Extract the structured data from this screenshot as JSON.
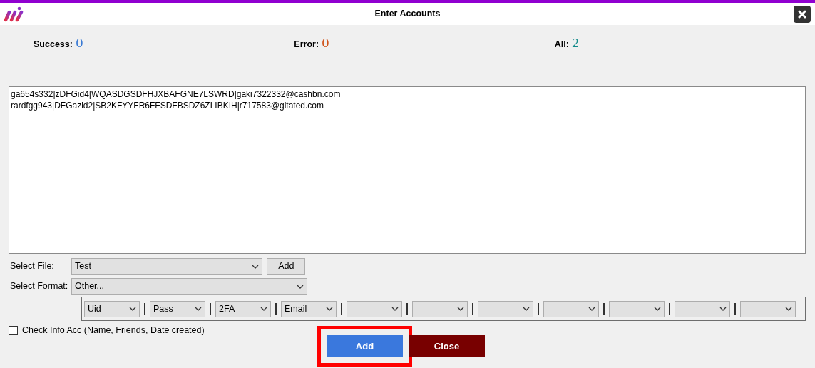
{
  "window": {
    "title": "Enter Accounts"
  },
  "stats": [
    {
      "label": "Success:",
      "value": "0",
      "color": "#3a7bd5"
    },
    {
      "label": "Error:",
      "value": "0",
      "color": "#d0531a"
    },
    {
      "label": "All:",
      "value": "2",
      "color": "#138a8a"
    }
  ],
  "accounts_text": {
    "lines": [
      "ga654s332|zDFGid4|WQASDGSDFHJXBAFGNE7LSWRD|gaki7322332@cashbn.com",
      "rardfgg943|DFGazid2|SB2KFYYFR6FFSDFBSDZ6ZLIBKIH|r717583@gitated.com"
    ]
  },
  "select_file": {
    "label": "Select File:",
    "value": "Test",
    "button": "Add"
  },
  "select_format": {
    "label": "Select Format:",
    "value": "Other..."
  },
  "format_columns": [
    {
      "kind": "set",
      "value": "Uid"
    },
    {
      "kind": "set",
      "value": "Pass"
    },
    {
      "kind": "set",
      "value": "2FA"
    },
    {
      "kind": "set",
      "value": "Email"
    },
    {
      "kind": "empty"
    },
    {
      "kind": "empty"
    },
    {
      "kind": "empty"
    },
    {
      "kind": "empty"
    },
    {
      "kind": "empty"
    },
    {
      "kind": "empty"
    },
    {
      "kind": "empty"
    }
  ],
  "check_info": {
    "label": "Check Info Acc (Name, Friends, Date created)",
    "checked": false
  },
  "buttons": [
    {
      "kind": "primary",
      "label": "Add",
      "highlighted": true
    },
    {
      "kind": "danger",
      "label": "Close",
      "highlighted": false
    }
  ]
}
